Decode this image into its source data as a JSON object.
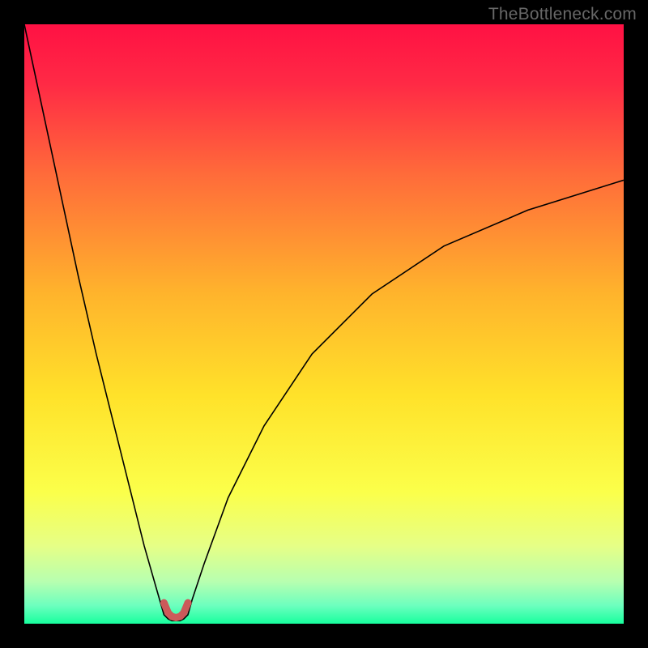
{
  "watermark": "TheBottleneck.com",
  "chart_data": {
    "type": "line",
    "title": "",
    "xlabel": "",
    "ylabel": "",
    "xlim": [
      0,
      100
    ],
    "ylim": [
      0,
      100
    ],
    "grid": false,
    "legend": false,
    "background": {
      "type": "vertical-gradient",
      "stops": [
        {
          "pos": 0.0,
          "color": "#ff1144"
        },
        {
          "pos": 0.1,
          "color": "#ff2a45"
        },
        {
          "pos": 0.25,
          "color": "#ff6b3a"
        },
        {
          "pos": 0.45,
          "color": "#ffb42c"
        },
        {
          "pos": 0.62,
          "color": "#ffe22a"
        },
        {
          "pos": 0.78,
          "color": "#fbff4a"
        },
        {
          "pos": 0.87,
          "color": "#e6ff86"
        },
        {
          "pos": 0.93,
          "color": "#b7ffb0"
        },
        {
          "pos": 0.97,
          "color": "#6cffbe"
        },
        {
          "pos": 1.0,
          "color": "#17ff9e"
        }
      ]
    },
    "series": [
      {
        "name": "bottleneck-curve",
        "stroke": "#000000",
        "stroke_width": 1.6,
        "x": [
          0,
          3,
          6,
          9,
          12,
          15,
          18,
          20,
          22,
          23.3,
          24,
          24.6,
          25.3,
          26.0,
          26.6,
          27.3,
          28,
          30,
          34,
          40,
          48,
          58,
          70,
          84,
          100
        ],
        "y": [
          100,
          86,
          72,
          58,
          45,
          33,
          21,
          13,
          6,
          1.5,
          0.8,
          0.5,
          0.5,
          0.5,
          0.8,
          1.5,
          4,
          10,
          21,
          33,
          45,
          55,
          63,
          69,
          74
        ]
      },
      {
        "name": "valley-marker",
        "stroke": "#cc5a5a",
        "stroke_width": 9,
        "linecap": "round",
        "x": [
          23.3,
          24.0,
          24.6,
          25.3,
          26.0,
          26.6,
          27.3
        ],
        "y": [
          3.5,
          1.8,
          1.2,
          1.0,
          1.2,
          1.8,
          3.5
        ]
      }
    ]
  }
}
